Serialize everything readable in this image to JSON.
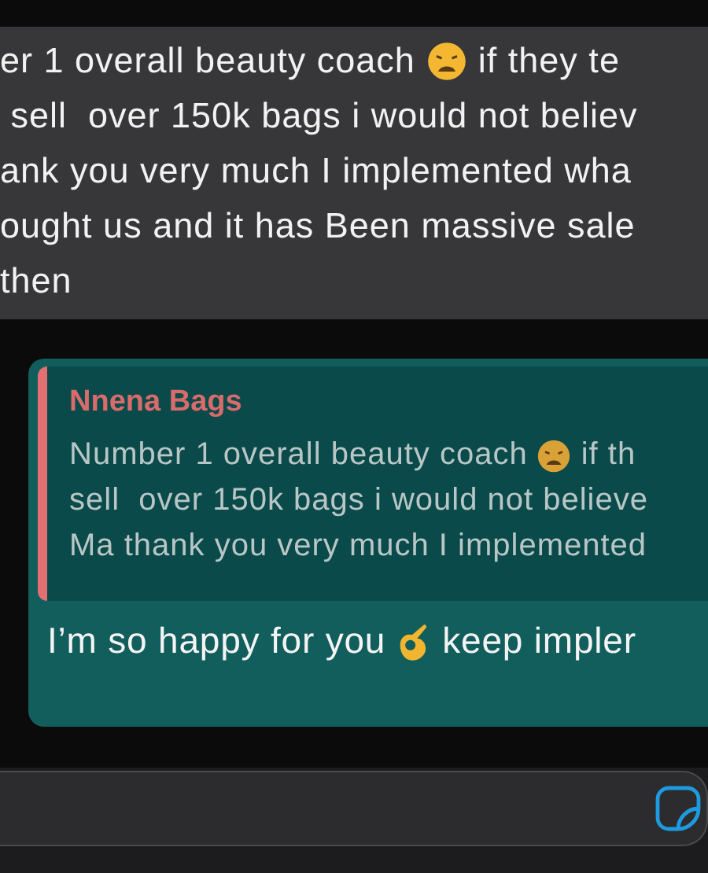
{
  "message": {
    "lines": [
      [
        {
          "kind": "text",
          "text": "er 1 overall beauty coach"
        },
        {
          "kind": "face"
        },
        {
          "kind": "text",
          "text": "if they te"
        }
      ],
      [
        {
          "kind": "text",
          "text": " sell  over 150k bags i would not believ"
        }
      ],
      [
        {
          "kind": "text",
          "text": "ank you very much I implemented wha"
        }
      ],
      [
        {
          "kind": "text",
          "text": "ought us and it has Been massive sale"
        }
      ],
      [
        {
          "kind": "text",
          "text": "then"
        }
      ]
    ]
  },
  "reply": {
    "quote": {
      "author": "Nnena Bags",
      "lines": [
        [
          {
            "kind": "text",
            "text": "Number 1 overall beauty coach"
          },
          {
            "kind": "face"
          },
          {
            "kind": "text",
            "text": "if th"
          }
        ],
        [
          {
            "kind": "text",
            "text": "sell  over 150k bags i would not believe"
          }
        ],
        [
          {
            "kind": "text",
            "text": "Ma thank you very much I implemented"
          }
        ]
      ]
    },
    "line": [
      {
        "kind": "text",
        "text": "I’m so happy for you"
      },
      {
        "kind": "hand"
      },
      {
        "kind": "text",
        "text": "keep impler"
      }
    ]
  }
}
